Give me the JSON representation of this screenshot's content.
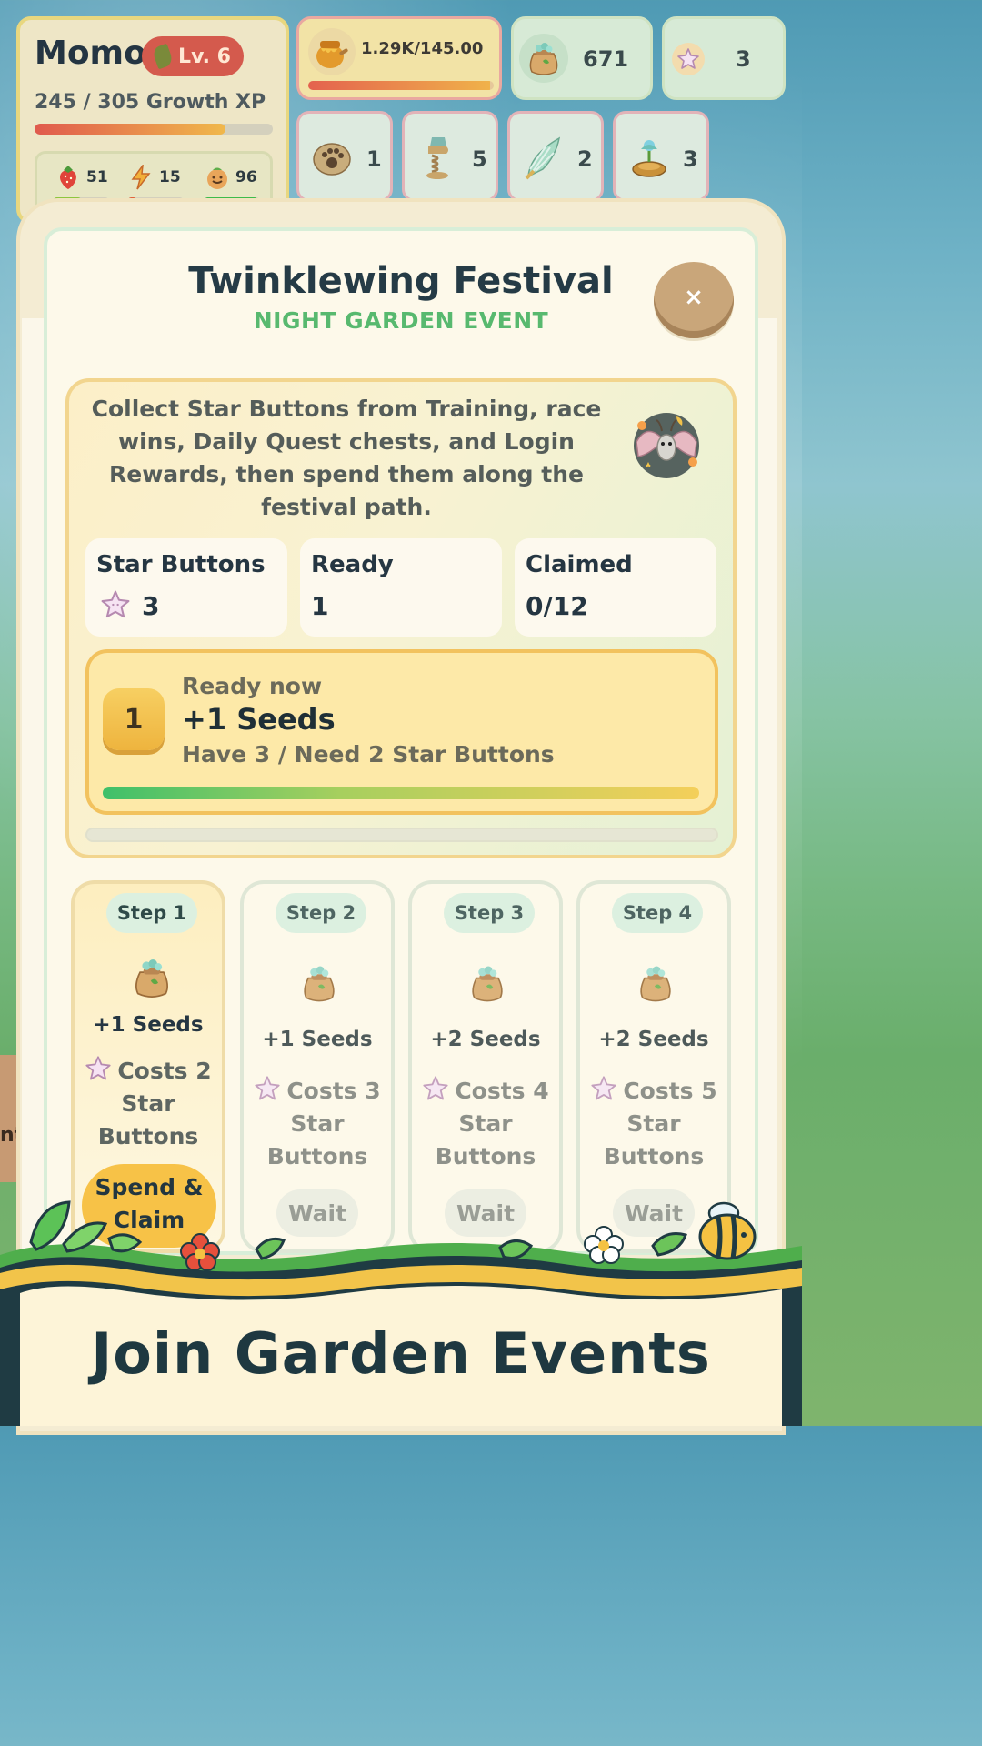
{
  "profile": {
    "name": "Momo",
    "level": "Lv. 6",
    "growth_text": "245 / 305 Growth XP",
    "growth_progress": 0.8,
    "stats": [
      {
        "icon": "strawberry-icon",
        "value": "51",
        "fill": 0.5,
        "color": "#8dc63f"
      },
      {
        "icon": "lightning-icon",
        "value": "15",
        "fill": 0.15,
        "color": "#e0643c"
      },
      {
        "icon": "happy-face-icon",
        "value": "96",
        "fill": 0.96,
        "color": "#3dbb4a"
      }
    ]
  },
  "resources": {
    "honey": {
      "icon": "honey-pot-icon",
      "text": "1.29K/145.00",
      "fill": 0.98
    },
    "seeds": {
      "icon": "seed-bag-icon",
      "value": "671"
    },
    "star_buttons": {
      "icon": "star-button-icon",
      "value": "3"
    }
  },
  "items": [
    {
      "icon": "paw-stone-icon",
      "value": "1"
    },
    {
      "icon": "spring-boots-icon",
      "value": "5"
    },
    {
      "icon": "wing-icon",
      "value": "2"
    },
    {
      "icon": "flower-disc-icon",
      "value": "3"
    }
  ],
  "modal": {
    "title": "Twinklewing Festival",
    "subtitle": "NIGHT GARDEN EVENT",
    "close_label": "×",
    "description": "Collect Star Buttons from Training, race wins, Daily Quest chests, and Login Rewards, then spend them along the festival path.",
    "stats": [
      {
        "label": "Star Buttons",
        "value": "3",
        "has_icon": true
      },
      {
        "label": "Ready",
        "value": "1",
        "has_icon": false
      },
      {
        "label": "Claimed",
        "value": "0/12",
        "has_icon": false
      }
    ],
    "ready": {
      "number": "1",
      "label": "Ready now",
      "title": "+1 Seeds",
      "subtitle": "Have 3 / Need 2 Star Buttons",
      "progress": 1.0
    },
    "steps": [
      {
        "chip": "Step 1",
        "reward": "+1 Seeds",
        "cost": "Costs 2 Star Buttons",
        "button": "Spend & Claim",
        "active": true
      },
      {
        "chip": "Step 2",
        "reward": "+1 Seeds",
        "cost": "Costs 3 Star Buttons",
        "button": "Wait",
        "active": false
      },
      {
        "chip": "Step 3",
        "reward": "+2 Seeds",
        "cost": "Costs 4 Star Buttons",
        "button": "Wait",
        "active": false
      },
      {
        "chip": "Step 4",
        "reward": "+2 Seeds",
        "cost": "Costs 5 Star Buttons",
        "button": "Wait",
        "active": false
      }
    ]
  },
  "banner": {
    "text": "Join Garden Events"
  },
  "background": {
    "partial_text": "nt"
  },
  "colors": {
    "accent_green": "#58b96f",
    "title_dark": "#253b46",
    "claim_yellow": "#f7c247",
    "level_red": "#d45a4d"
  }
}
